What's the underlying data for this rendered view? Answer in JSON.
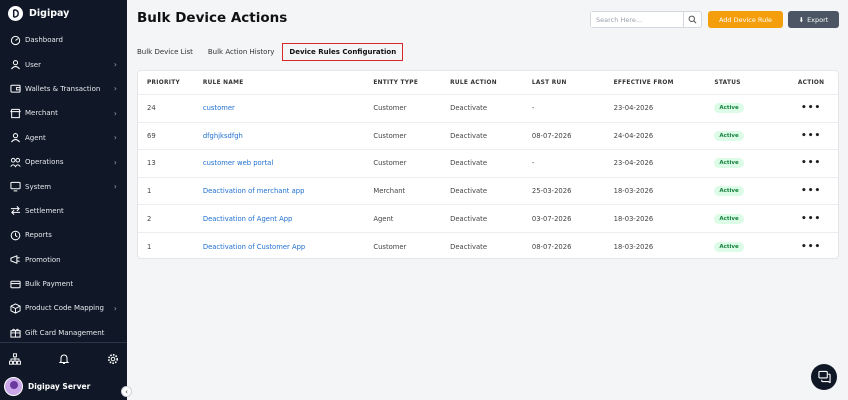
{
  "brand": {
    "name": "Digipay"
  },
  "sidebar": {
    "items": [
      {
        "label": "Dashboard",
        "icon": "dashboard-icon",
        "chevron": false
      },
      {
        "label": "User",
        "icon": "user-icon",
        "chevron": true
      },
      {
        "label": "Wallets & Transaction",
        "icon": "wallet-icon",
        "chevron": true
      },
      {
        "label": "Merchant",
        "icon": "merchant-icon",
        "chevron": true
      },
      {
        "label": "Agent",
        "icon": "agent-icon",
        "chevron": true
      },
      {
        "label": "Operations",
        "icon": "operations-icon",
        "chevron": true
      },
      {
        "label": "System",
        "icon": "system-icon",
        "chevron": true
      },
      {
        "label": "Settlement",
        "icon": "settlement-icon",
        "chevron": false
      },
      {
        "label": "Reports",
        "icon": "reports-icon",
        "chevron": false
      },
      {
        "label": "Promotion",
        "icon": "promotion-icon",
        "chevron": false
      },
      {
        "label": "Bulk Payment",
        "icon": "bulk-payment-icon",
        "chevron": false
      },
      {
        "label": "Product Code Mapping",
        "icon": "product-code-icon",
        "chevron": true
      },
      {
        "label": "Gift Card Management",
        "icon": "gift-card-icon",
        "chevron": false
      }
    ],
    "bottom_icons": [
      "hierarchy-icon",
      "bell-icon",
      "gear-icon"
    ],
    "user": {
      "name": "Digipay Server"
    }
  },
  "header": {
    "title": "Bulk Device Actions",
    "search_placeholder": "Search Here...",
    "add_label": "Add Device Rule",
    "export_label": "Export"
  },
  "tabs": [
    {
      "label": "Bulk Device List",
      "active": false
    },
    {
      "label": "Bulk Action History",
      "active": false
    },
    {
      "label": "Device Rules Configuration",
      "active": true
    }
  ],
  "table": {
    "columns": [
      "PRIORITY",
      "RULE NAME",
      "ENTITY TYPE",
      "RULE ACTION",
      "LAST RUN",
      "EFFECTIVE FROM",
      "STATUS",
      "ACTION"
    ],
    "rows": [
      {
        "priority": "24",
        "rule_name": "customer",
        "entity_type": "Customer",
        "rule_action": "Deactivate",
        "last_run": "-",
        "effective_from": "23-04-2026",
        "status": "Active"
      },
      {
        "priority": "69",
        "rule_name": "dfghjksdfgh",
        "entity_type": "Customer",
        "rule_action": "Deactivate",
        "last_run": "08-07-2026",
        "effective_from": "24-04-2026",
        "status": "Active"
      },
      {
        "priority": "13",
        "rule_name": "customer web portal",
        "entity_type": "Customer",
        "rule_action": "Deactivate",
        "last_run": "-",
        "effective_from": "23-04-2026",
        "status": "Active"
      },
      {
        "priority": "1",
        "rule_name": "Deactivation of merchant app",
        "entity_type": "Merchant",
        "rule_action": "Deactivate",
        "last_run": "25-03-2026",
        "effective_from": "18-03-2026",
        "status": "Active"
      },
      {
        "priority": "2",
        "rule_name": "Deactivation of Agent App",
        "entity_type": "Agent",
        "rule_action": "Deactivate",
        "last_run": "03-07-2026",
        "effective_from": "18-03-2026",
        "status": "Active"
      },
      {
        "priority": "1",
        "rule_name": "Deactivation of Customer App",
        "entity_type": "Customer",
        "rule_action": "Deactivate",
        "last_run": "08-07-2026",
        "effective_from": "18-03-2026",
        "status": "Active"
      }
    ],
    "action_glyph": "•••"
  },
  "colors": {
    "accent": "#f59e0b",
    "sidebar_bg": "#101828",
    "link": "#1f6fd1",
    "active_badge": "#dcfce7"
  }
}
